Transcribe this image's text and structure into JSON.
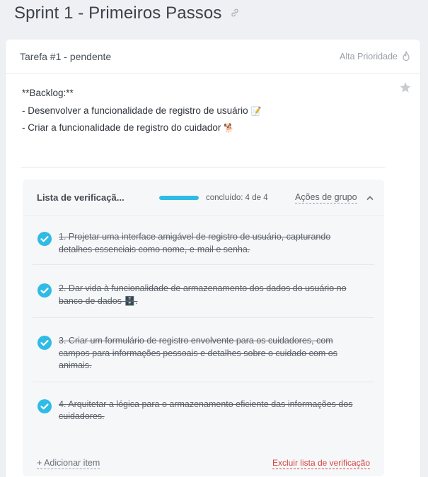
{
  "page": {
    "title": "Sprint 1 - Primeiros Passos",
    "link_icon": "link-icon"
  },
  "task": {
    "title": "Tarefa #1 - pendente",
    "priority_label": "Alta Prioridade",
    "priority_icon": "flame-icon",
    "star_icon": "star-icon",
    "description": {
      "line1": "**Backlog:**",
      "line2": "- Desenvolver a funcionalidade de registro de usuário",
      "line2_emoji": "📝",
      "line3": "- Criar a funcionalidade de registro do cuidador",
      "line3_emoji": "🐕"
    }
  },
  "checklist": {
    "title": "Lista de verificaçã...",
    "progress_text": "concluído: 4 de 4",
    "progress_fraction": 1.0,
    "group_actions_label": "Ações de grupo",
    "collapse_icon": "chevron-up-icon",
    "accent_color": "#2fbbe6",
    "items": [
      {
        "number": "1.",
        "text": "Projetar uma interface amigável de registro de usuário, capturando detalhes essenciais como nome, e-mail e senha.",
        "done": true
      },
      {
        "number": "2.",
        "text": "Dar vida à funcionalidade de armazenamento dos dados do usuário no banco de dados 🗄️.",
        "done": true
      },
      {
        "number": "3.",
        "text": "Criar um formulário de registro envolvente para os cuidadores, com campos para informações pessoais e detalhes sobre o cuidado com os animais.",
        "done": true
      },
      {
        "number": "4.",
        "text": "Arquitetar a lógica para o armazenamento eficiente das informações dos cuidadores.",
        "done": true
      }
    ],
    "add_item_label": "+ Adicionar item",
    "delete_label": "Excluir lista de verificação",
    "delete_color": "#d6443c"
  }
}
